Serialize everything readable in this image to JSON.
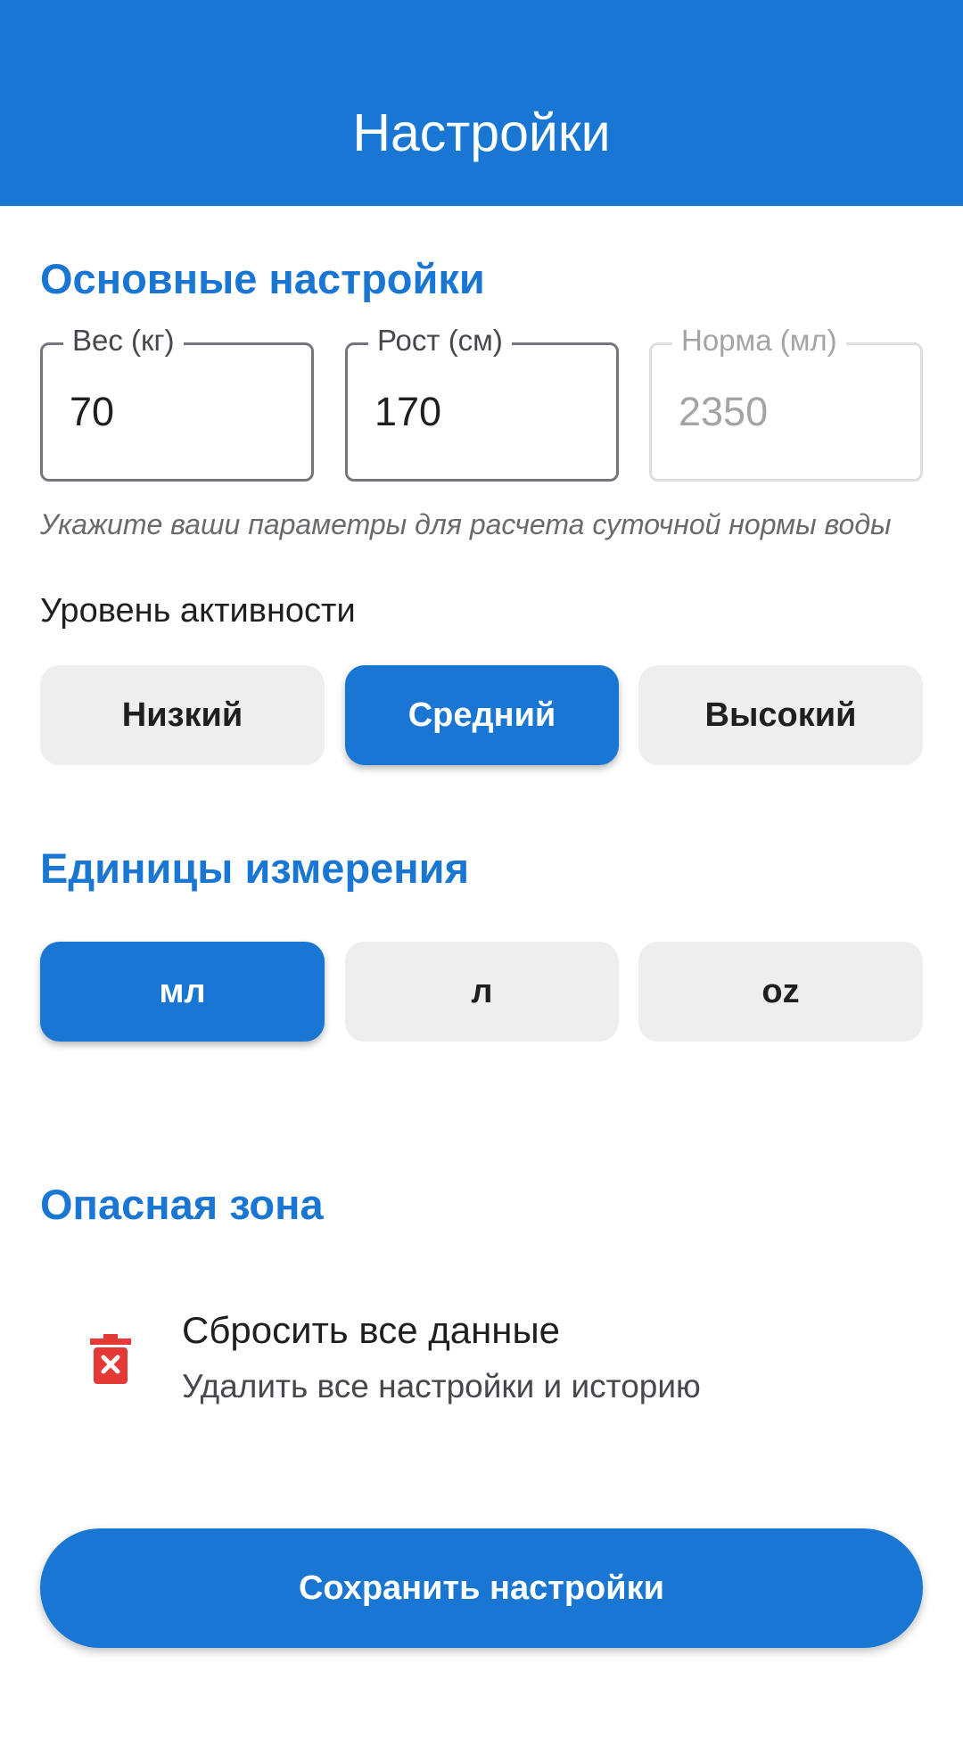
{
  "appbar": {
    "title": "Настройки"
  },
  "basic": {
    "title": "Основные настройки",
    "fields": [
      {
        "label": "Вес (кг)",
        "value": "70",
        "enabled": true
      },
      {
        "label": "Рост (см)",
        "value": "170",
        "enabled": true
      },
      {
        "label": "Норма (мл)",
        "value": "2350",
        "enabled": false
      }
    ],
    "helper": "Укажите ваши параметры для расчета суточной нормы воды"
  },
  "activity": {
    "label": "Уровень активности",
    "options": [
      "Низкий",
      "Средний",
      "Высокий"
    ],
    "selected": "Средний"
  },
  "units": {
    "title": "Единицы измерения",
    "options": [
      "мл",
      "л",
      "oz"
    ],
    "selected": "мл"
  },
  "danger": {
    "title": "Опасная зона",
    "reset": {
      "icon": "trash-icon",
      "title": "Сбросить все данные",
      "subtitle": "Удалить все настройки и историю"
    }
  },
  "save": {
    "label": "Сохранить настройки"
  },
  "colors": {
    "primary": "#1976d2",
    "danger_icon": "#e53935",
    "chip_inactive": "#eeeeee"
  }
}
